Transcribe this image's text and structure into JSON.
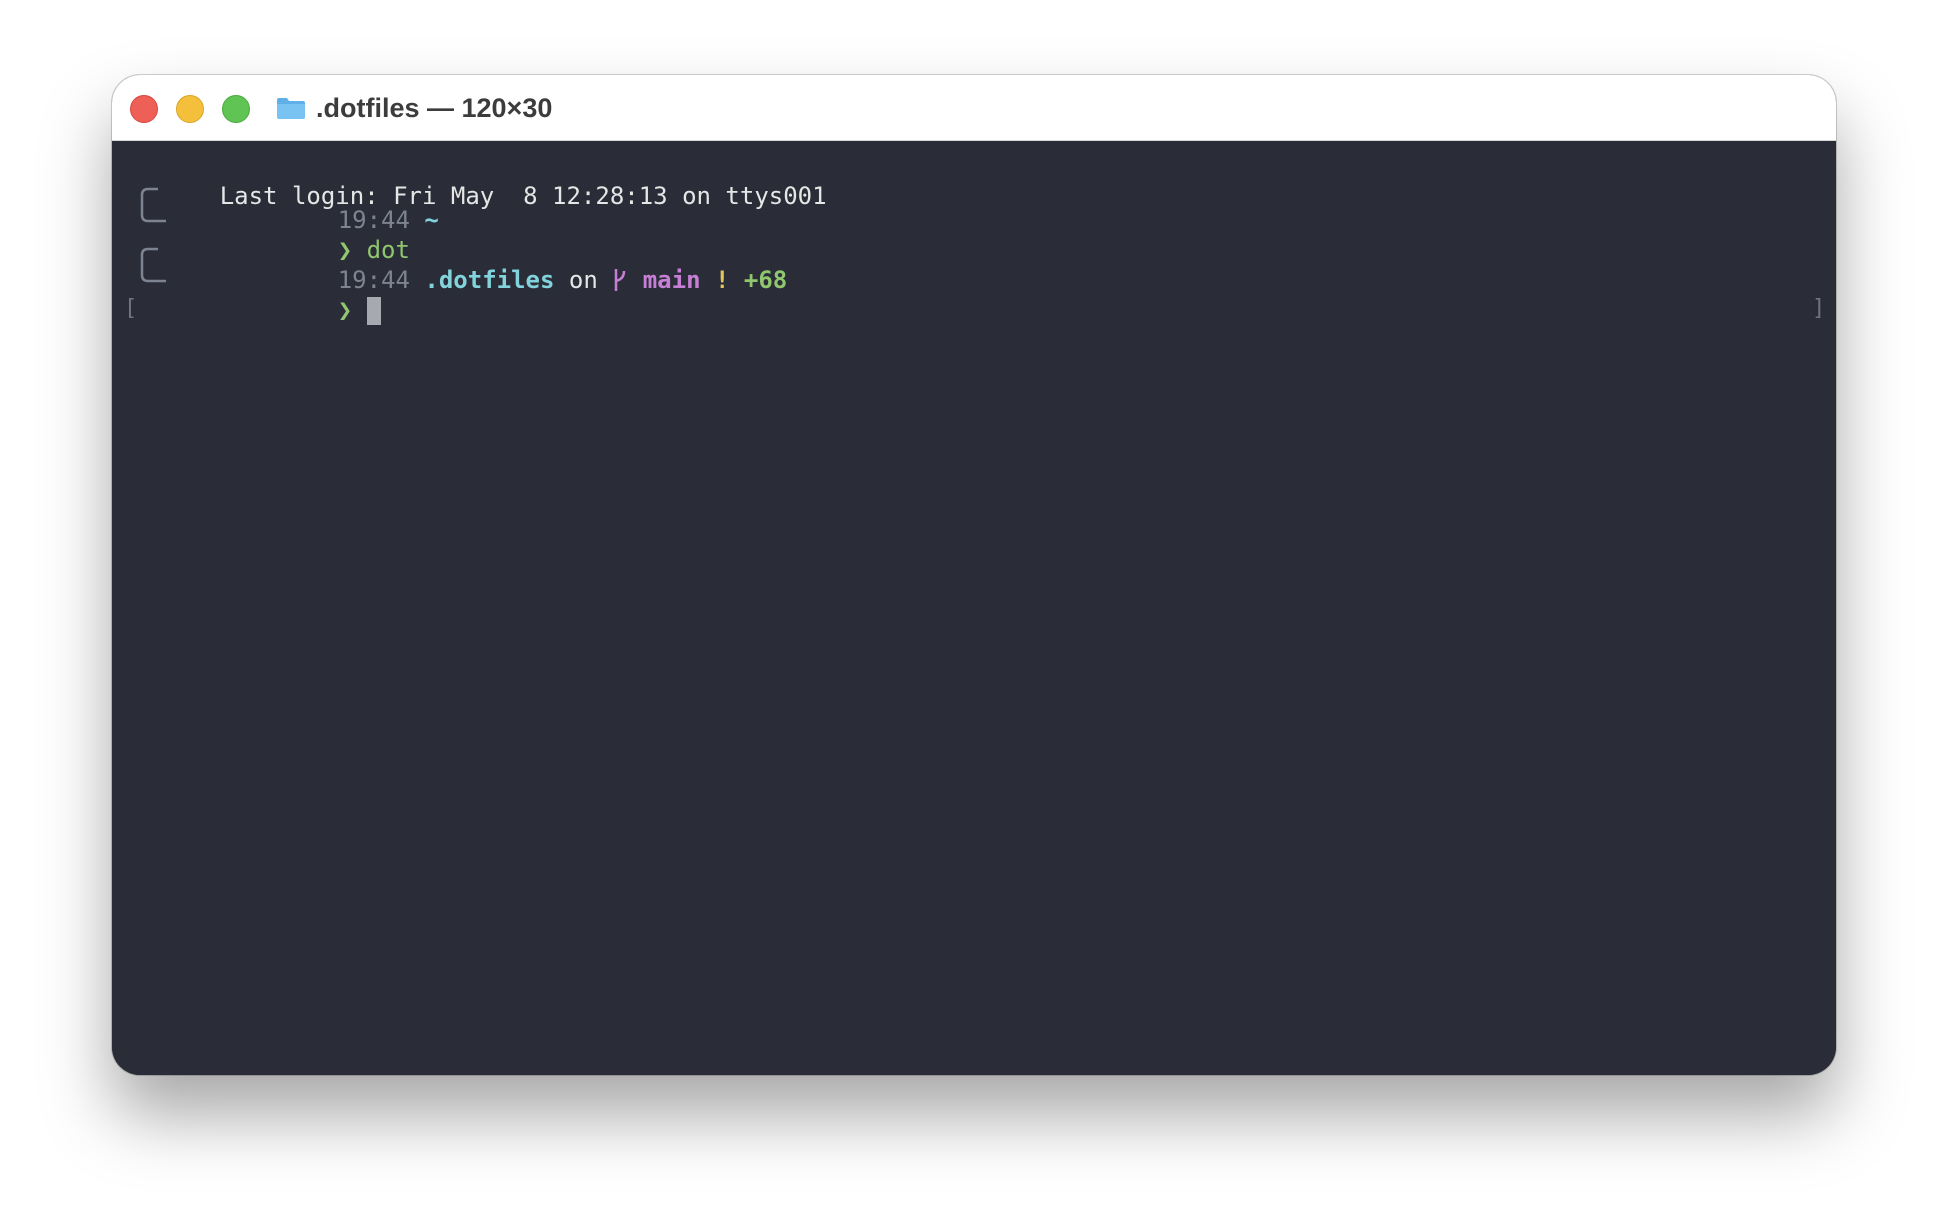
{
  "window": {
    "title": ".dotfiles — 120×30",
    "folder_icon": "folder-icon",
    "colors": {
      "close": "#ee5f57",
      "minimize": "#f4bf3a",
      "maximize": "#5fc454",
      "terminal_bg": "#2a2d38"
    }
  },
  "terminal": {
    "last_login": "Last login: Fri May  8 12:28:13 on ttys001",
    "prompt1": {
      "time": "19:44",
      "dir": "~"
    },
    "command1": {
      "arrow": "❯",
      "text": "dot"
    },
    "prompt2": {
      "time": "19:44",
      "dir": ".dotfiles",
      "on": "on",
      "branch_icon": "",
      "branch": "main",
      "status_flag": "!",
      "status_count": "+68"
    },
    "command2": {
      "arrow": "❯",
      "text": ""
    },
    "mark_left": "[",
    "mark_right": "]"
  }
}
